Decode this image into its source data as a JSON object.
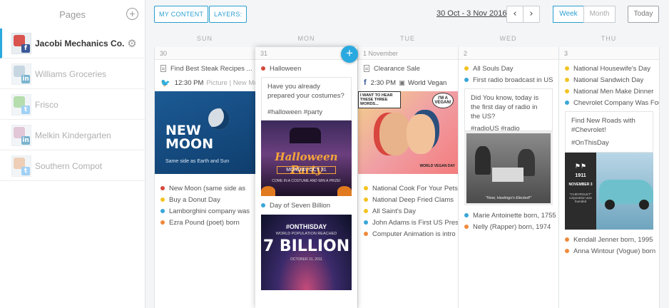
{
  "sidebar": {
    "title": "Pages",
    "add_icon": "plus-circle-icon",
    "pages": [
      {
        "name": "Jacobi Mechanics Co.",
        "network": "f",
        "active": true
      },
      {
        "name": "Williams Groceries",
        "network": "in",
        "active": false
      },
      {
        "name": "Frisco",
        "network": "t",
        "active": false
      },
      {
        "name": "Melkin Kindergarten",
        "network": "in",
        "active": false
      },
      {
        "name": "Southern Compot",
        "network": "t",
        "active": false
      }
    ]
  },
  "toolbar": {
    "my_content": "MY CONTENT",
    "layers": "LAYERS:",
    "date_range": "30 Oct - 3 Nov 2016",
    "prev": "‹",
    "next": "›",
    "week": "Week",
    "month": "Month",
    "today": "Today",
    "add_post": "+"
  },
  "days": [
    {
      "head": "SUN",
      "num": "30",
      "top": [
        {
          "kind": "doc",
          "text": "Find Best Steak Recipes ..."
        }
      ],
      "post": {
        "network": "twitter",
        "time": "12:30 PM",
        "meta": "Picture | New Moo",
        "image": {
          "title": "NEW MOON",
          "caption": "Same side as Earth and Sun"
        }
      },
      "bottom": [
        {
          "dot": "red",
          "text": "New Moon (same side as"
        },
        {
          "dot": "yellow",
          "text": "Buy a Donut Day"
        },
        {
          "dot": "blue",
          "text": "Lamborghini company was"
        },
        {
          "dot": "orange",
          "text": "Ezra Pound (poet) born"
        }
      ]
    },
    {
      "head": "MON",
      "num": "31",
      "top": [
        {
          "kind": "dot",
          "dot": "red",
          "text": "Halloween"
        }
      ],
      "post": {
        "lines": [
          "Have you already prepared your costumes?",
          "#halloween #party"
        ],
        "image": {
          "title": "Halloween Party",
          "date": "MONDAY OCT 31",
          "small": "COME IN A COSTUME AND WIN A PRIZE!"
        }
      },
      "bottom": [
        {
          "dot": "blue",
          "text": "Day of Seven Billion"
        }
      ],
      "image2": {
        "tag": "#ONTHISDAY",
        "sub": "WORLD POPULATION REACHED",
        "big": "7 BILLION",
        "date": "OCTOBER 31, 2011"
      }
    },
    {
      "head": "TUE",
      "num": "1 November",
      "top": [
        {
          "kind": "doc",
          "text": "Clearance Sale"
        }
      ],
      "post": {
        "network": "facebook",
        "time": "2:30 PM",
        "meta": "World Vegan",
        "image": {
          "bubble1": "I WANT TO HEAR THESE THREE WORDS...",
          "bubble2": "I'M A VEGAN!",
          "small": "WORLD VEGAN DAY"
        }
      },
      "bottom": [
        {
          "dot": "yellow",
          "text": "National Cook For Your Pets"
        },
        {
          "dot": "yellow",
          "text": "National Deep Fried Clams"
        },
        {
          "dot": "yellow",
          "text": "All Saint's Day"
        },
        {
          "dot": "blue",
          "text": "John Adams is First US Pres"
        },
        {
          "dot": "orange",
          "text": "Computer Animation is intro"
        }
      ]
    },
    {
      "head": "WED",
      "num": "2",
      "top": [
        {
          "kind": "dot",
          "dot": "yellow",
          "text": "All Souls Day"
        },
        {
          "kind": "dot",
          "dot": "blue",
          "text": "First radio broadcast in US"
        }
      ],
      "post": {
        "lines": [
          "Did You know, today is the first day of radio in the US?",
          "#radioUS #radio"
        ],
        "image": {
          "caption": "\"Now, Hastings's Elected!\""
        }
      },
      "bottom": [
        {
          "dot": "blue",
          "text": "Marie Antoinette born, 1755"
        },
        {
          "dot": "orange",
          "text": "Nelly (Rapper) born, 1974"
        }
      ]
    },
    {
      "head": "THU",
      "num": "3",
      "top": [
        {
          "kind": "dot",
          "dot": "yellow",
          "text": "National Housewife's Day"
        },
        {
          "kind": "dot",
          "dot": "yellow",
          "text": "National Sandwich Day"
        },
        {
          "kind": "dot",
          "dot": "yellow",
          "text": "National Men Make Dinner"
        },
        {
          "kind": "dot",
          "dot": "blue",
          "text": "Chevrolet Company Was Fou"
        }
      ],
      "post": {
        "lines": [
          "Find New Roads with #Chevrolet!",
          "#OnThisDay"
        ],
        "image": {
          "year": "1911",
          "date": "NOVEMBER 3",
          "small": "\"CHEVROLET\" corporation was founded"
        }
      },
      "bottom": [
        {
          "dot": "orange",
          "text": "Kendall Jenner born, 1995"
        },
        {
          "dot": "orange",
          "text": "Anna Wintour (Vogue) born"
        }
      ]
    }
  ],
  "colors": {
    "accent": "#29a9df",
    "red": "#d34a3a",
    "yellow": "#f3c321",
    "blue": "#3aa6d8",
    "orange": "#ef8a3c"
  }
}
